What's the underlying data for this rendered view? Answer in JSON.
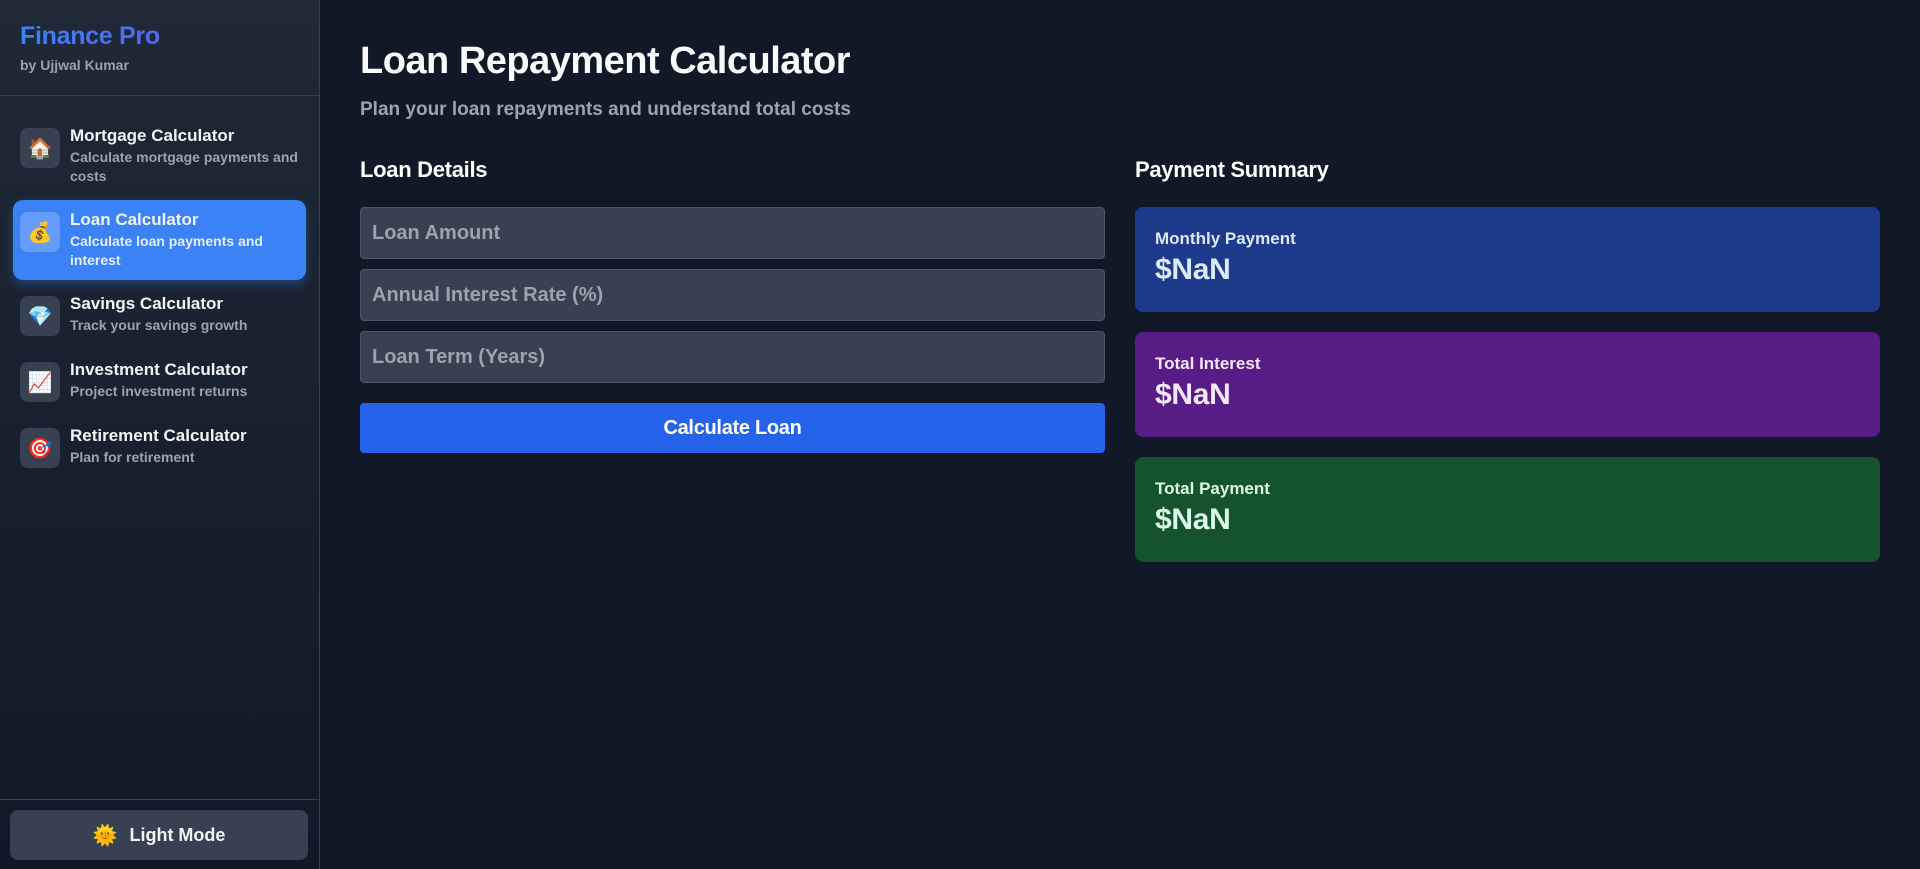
{
  "brand": {
    "title": "Finance Pro",
    "subtitle": "by Ujjwal Kumar"
  },
  "sidebar": {
    "items": [
      {
        "icon": "🏠",
        "label": "Mortgage Calculator",
        "desc": "Calculate mortgage payments and costs"
      },
      {
        "icon": "💰",
        "label": "Loan Calculator",
        "desc": "Calculate loan payments and interest",
        "active": true
      },
      {
        "icon": "💎",
        "label": "Savings Calculator",
        "desc": "Track your savings growth"
      },
      {
        "icon": "📈",
        "label": "Investment Calculator",
        "desc": "Project investment returns"
      },
      {
        "icon": "🎯",
        "label": "Retirement Calculator",
        "desc": "Plan for retirement"
      }
    ],
    "mode_button": {
      "icon": "🌞",
      "label": "Light Mode"
    }
  },
  "main": {
    "title": "Loan Repayment Calculator",
    "subtitle": "Plan your loan repayments and understand total costs",
    "loan_details": {
      "title": "Loan Details",
      "fields": {
        "amount": {
          "placeholder": "Loan Amount",
          "value": ""
        },
        "rate": {
          "placeholder": "Annual Interest Rate (%)",
          "value": ""
        },
        "term": {
          "placeholder": "Loan Term (Years)",
          "value": ""
        }
      },
      "button": "Calculate Loan"
    },
    "summary": {
      "title": "Payment Summary",
      "monthly": {
        "label": "Monthly Payment",
        "value": "$NaN"
      },
      "interest": {
        "label": "Total Interest",
        "value": "$NaN"
      },
      "total": {
        "label": "Total Payment",
        "value": "$NaN"
      }
    }
  },
  "colors": {
    "accent": "#3b82f6",
    "button": "#2563eb",
    "monthly_card": "#1e3a8a",
    "interest_card": "#581c87",
    "total_card": "#14532d"
  }
}
